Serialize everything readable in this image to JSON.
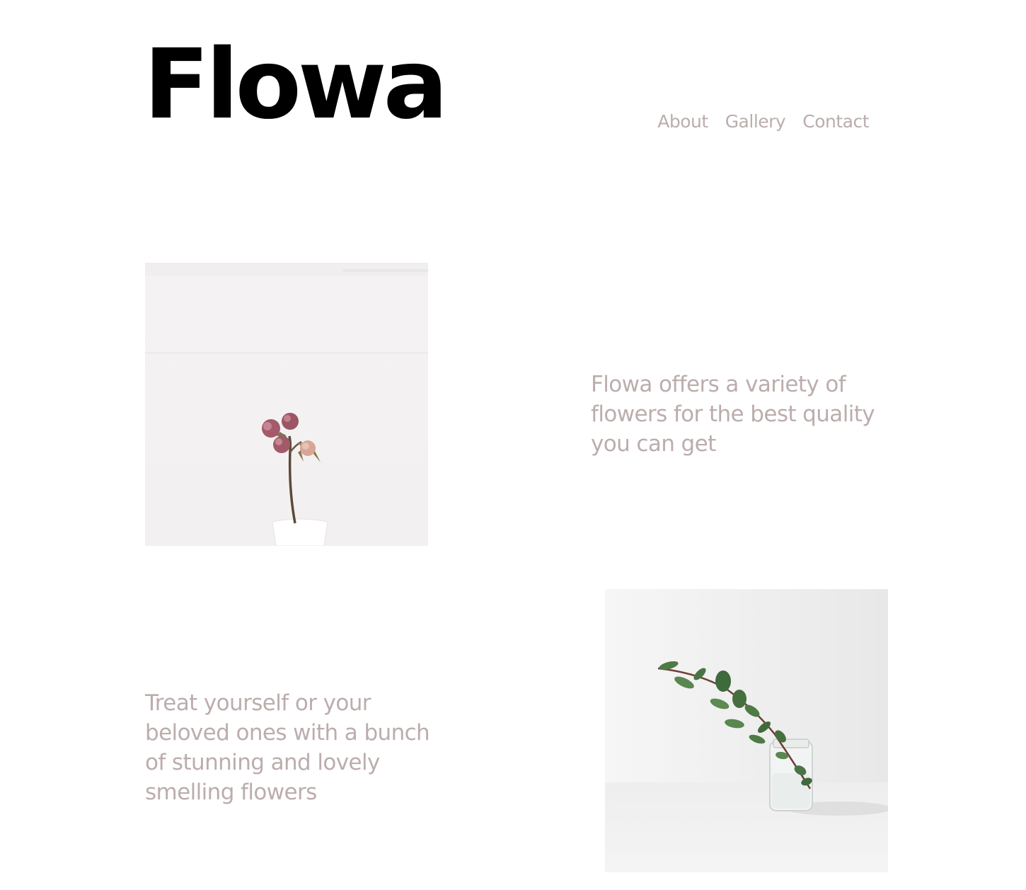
{
  "brand": {
    "logo_text": "Flowa"
  },
  "nav": {
    "items": [
      {
        "label": "About"
      },
      {
        "label": "Gallery"
      },
      {
        "label": "Contact"
      }
    ]
  },
  "sections": [
    {
      "image_icon": "dried-roses-in-vase-photo",
      "text": "Flowa offers a variety of flowers for the best quality you can get"
    },
    {
      "image_icon": "eucalyptus-sprig-in-glass-jar-photo",
      "text": "Treat yourself or your beloved ones with a bunch of stunning and lovely smelling flowers"
    }
  ],
  "colors": {
    "background": "#ffffff",
    "logo": "#000000",
    "muted_text": "#bcadad"
  }
}
